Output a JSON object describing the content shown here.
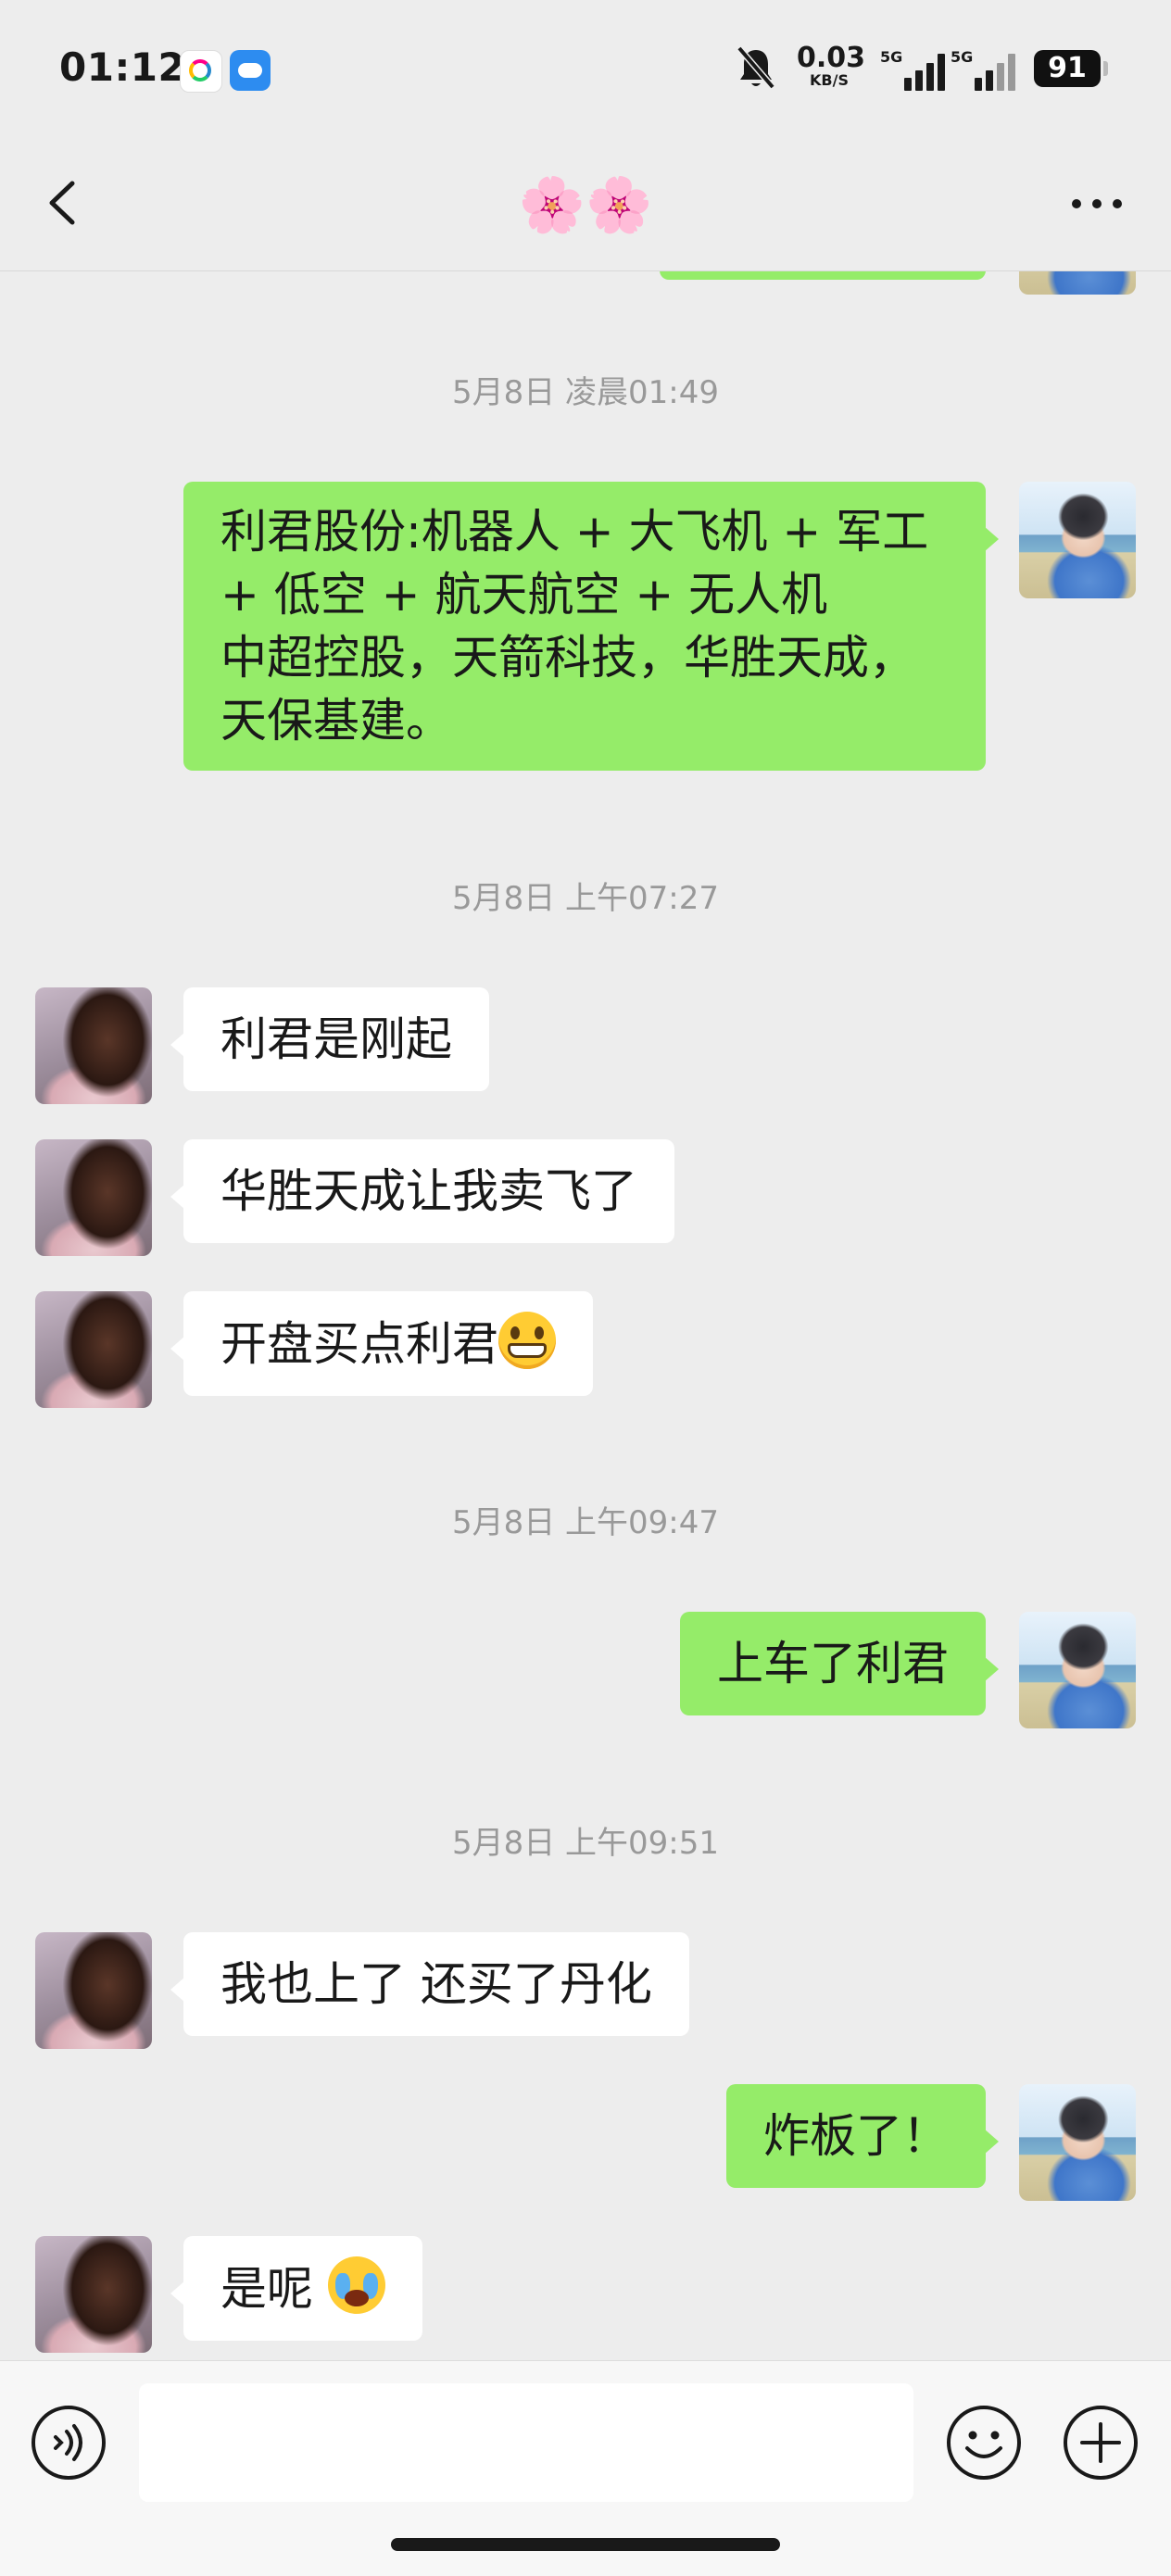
{
  "status_bar": {
    "time": "01:12",
    "net_speed_value": "0.03",
    "net_speed_unit": "KB/S",
    "signal_1": "5G",
    "signal_2": "5G",
    "battery": "91",
    "icons": [
      "app-icon",
      "weather-icon",
      "mute-bell-icon",
      "signal-icon",
      "battery-icon"
    ]
  },
  "nav": {
    "title": "🌸🌸",
    "back_icon": "chevron-left-icon",
    "more_icon": "more-dots-icon"
  },
  "chat": {
    "timestamps": [
      "5月8日 凌晨01:49",
      "5月8日 上午07:27",
      "5月8日 上午09:47",
      "5月8日 上午09:51"
    ],
    "messages": [
      {
        "side": "right",
        "text": "利君股份:机器人 + 大飞机 + 军工\n+ 低空 + 航天航空 + 无人机\n中超控股，天箭科技，华胜天成，\n天保基建。"
      },
      {
        "side": "left",
        "text": "利君是刚起"
      },
      {
        "side": "left",
        "text": "华胜天成让我卖飞了"
      },
      {
        "side": "left",
        "text": "开盘买点利君",
        "emoji": "grimacing-face"
      },
      {
        "side": "right",
        "text": "上车了利君"
      },
      {
        "side": "left",
        "text": "我也上了 还买了丹化"
      },
      {
        "side": "right",
        "text": "炸板了！"
      },
      {
        "side": "left",
        "text": "是呢 ",
        "emoji": "loudly-crying-face"
      }
    ]
  },
  "input_bar": {
    "value": "",
    "icons": [
      "voice-icon",
      "emoji-icon",
      "plus-icon"
    ]
  },
  "colors": {
    "background": "#ededed",
    "sent_bubble": "#95ec69",
    "received_bubble": "#ffffff",
    "timestamp_text": "#999999"
  }
}
